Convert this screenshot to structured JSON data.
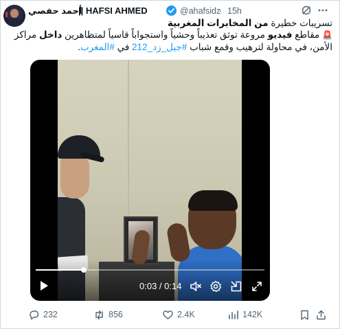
{
  "author": {
    "name_ar": "أحمد حفصي",
    "name_en": "|| HAFSI AHMED",
    "handle": "@ahafsidz",
    "separator": "·",
    "time": "15h"
  },
  "tweet": {
    "line1_a": "تسريبات خطيرة ",
    "line1_b": "من المخابرات المغربية",
    "line2_a": "مقاطع ",
    "line2_b": "فيديو",
    "line2_c": " مروعة توثق تعذيباً وحشياً واستجواباً قاسياً لمتظاهرين ",
    "line2_d": "داخل",
    "line2_e": " مراكز",
    "line3_a": "الأمن، في محاولة لترهيب وقمع شباب ",
    "hashtag1": "#جيل_زد_212",
    "line3_b": " في ",
    "hashtag2": "#المغرب",
    "line3_c": "."
  },
  "video": {
    "current_time": "0:03",
    "time_separator": " / ",
    "duration": "0:14",
    "progress_fraction": 0.21
  },
  "actions": {
    "replies": "232",
    "reposts": "856",
    "likes": "2.4K",
    "views": "142K"
  },
  "colors": {
    "accent": "#1d9bf0",
    "text": "#0f1419",
    "muted": "#536471",
    "siren": "#e0245e"
  },
  "icons": {
    "verified": "verified-badge-icon",
    "grok": "grok-icon",
    "more": "more-icon",
    "siren": "siren-icon",
    "play": "play-icon",
    "volume": "volume-muted-icon",
    "settings": "gear-icon",
    "pip": "picture-in-picture-icon",
    "fullscreen": "fullscreen-icon",
    "reply": "reply-icon",
    "repost": "repost-icon",
    "like": "heart-icon",
    "views": "views-icon",
    "bookmark": "bookmark-icon",
    "share": "share-icon"
  }
}
